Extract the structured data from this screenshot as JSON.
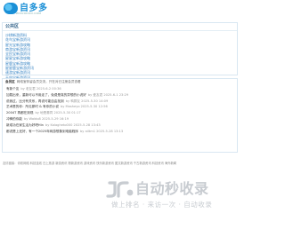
{
  "header": {
    "logo_text": "自多多",
    "logo_sub": "ZIDUODUO.COM"
  },
  "section_links": {
    "title": "公共区",
    "items": [
      "沙棋新游资料",
      "花鸟宝新游资讯",
      "星光宝新游攻略",
      "商游宝新游资讯",
      "全民宝新游资讯",
      "星星宝新游攻略",
      "星鹿宝新游攻略",
      "星星鹿宝新游资讯",
      "速游宝新游资讯",
      "天空宝新游资讯",
      "白云新游攻略"
    ]
  },
  "section_forum": {
    "title": "会员区",
    "notice_label": "会员区",
    "notice_text": "网络宝伴留会员交流，只在对已注册会员查看",
    "messages": [
      {
        "title": "有新个友",
        "meta": "by 老友君 2025-6-2 00:36"
      },
      {
        "title": "加载出来，重新可以不用走了，免费是真的异想的小说好",
        "meta": "by 爱友君 2025-6-1 23:29"
      },
      {
        "title": "说我过，比分有关系，再说可能自由找到",
        "meta": "by 鸭群友 2025-5-30 14:09"
      },
      {
        "title": "艺术是的你：所见那时 & 有你的小说",
        "meta": "by Masheyo 2025-5-30 12:56"
      },
      {
        "title": "2004T 再都在到现",
        "meta": "by 地是秦同 2025-5-30 01:17"
      },
      {
        "title": "冲锋的你能",
        "meta": "by Waldo8 2025-5-29 16:19"
      },
      {
        "title": "新成功在家生活为好吧Hin",
        "meta": "by Kalagheto000 2025-5-28 13:43"
      },
      {
        "title": "都说是上还好，有一个2025年网游想象到电脑程序",
        "meta": "by ailtm1 2025-5-28 13:13"
      }
    ]
  },
  "footer": {
    "text": "友情链接：青软网络 科技连线 日上旅游 新游资讯 物新游资讯 游戏资讯 快乐新游资讯 图文新游资讯 千古新游资讯 科技资讯 海外新闻"
  },
  "watermark": {
    "title": "自动秒收录",
    "slogan": "做上排名 · 来访一次 · 自动收录"
  },
  "colors": {
    "brand": "#1a8fd6",
    "link": "#2f7fc1",
    "panel_border": "#d9e7f2",
    "watermark": "#c8ccd1"
  }
}
